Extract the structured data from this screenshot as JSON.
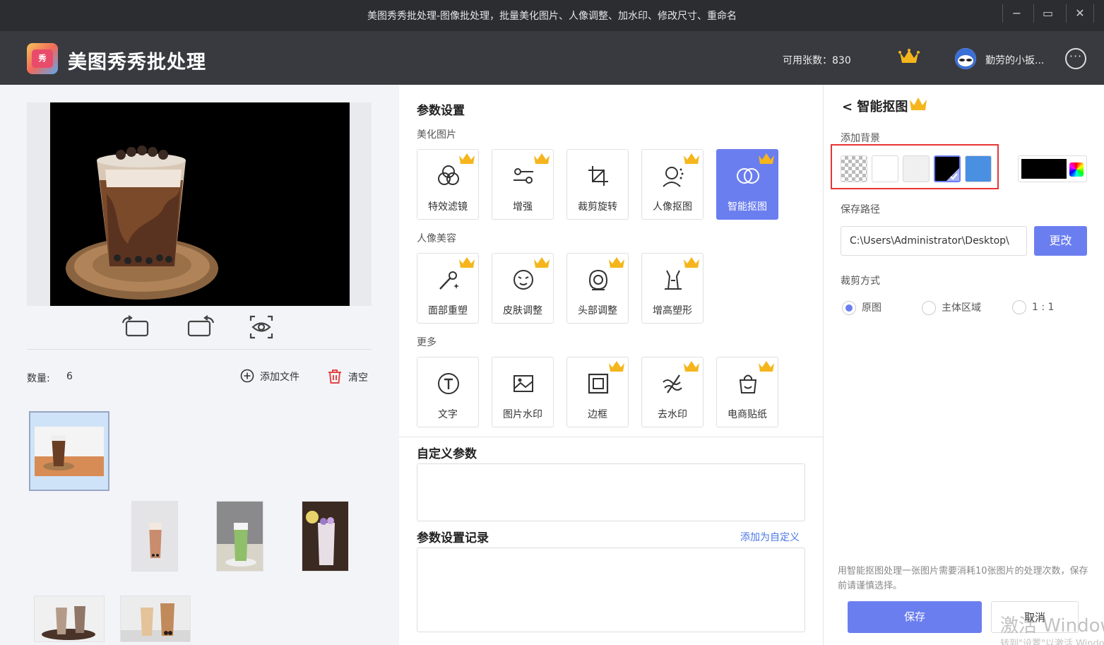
{
  "window": {
    "title": "美图秀秀批处理-图像批处理，批量美化图片、人像调整、加水印、修改尺寸、重命名",
    "minimize": "−",
    "maximize": "▭",
    "close": "✕"
  },
  "header": {
    "logo_text": "秀",
    "app_title": "美图秀秀批处理",
    "quota": "可用张数：830",
    "username": "勤劳的小扳...",
    "more": "···"
  },
  "left": {
    "count_label": "数量:",
    "count_value": "6",
    "add_file": "添加文件",
    "clear": "清空"
  },
  "middle": {
    "params_title": "参数设置",
    "group_beautify": "美化图片",
    "beautify_tools": [
      {
        "label": "特效滤镜",
        "icon": "filter-icon"
      },
      {
        "label": "增强",
        "icon": "sliders-icon"
      },
      {
        "label": "裁剪旋转",
        "icon": "crop-icon"
      },
      {
        "label": "人像抠图",
        "icon": "portrait-cutout-icon"
      },
      {
        "label": "智能抠图",
        "icon": "smart-cutout-icon"
      }
    ],
    "group_portrait": "人像美容",
    "portrait_tools": [
      {
        "label": "面部重塑",
        "icon": "magic-wand-icon"
      },
      {
        "label": "皮肤调整",
        "icon": "face-icon"
      },
      {
        "label": "头部调整",
        "icon": "head-icon"
      },
      {
        "label": "增高塑形",
        "icon": "body-icon"
      }
    ],
    "group_more": "更多",
    "more_tools": [
      {
        "label": "文字",
        "icon": "text-icon"
      },
      {
        "label": "图片水印",
        "icon": "image-watermark-icon"
      },
      {
        "label": "边框",
        "icon": "frame-icon"
      },
      {
        "label": "去水印",
        "icon": "remove-watermark-icon"
      },
      {
        "label": "电商贴纸",
        "icon": "sticker-icon"
      }
    ],
    "custom_title": "自定义参数",
    "history_title": "参数设置记录",
    "add_custom": "添加为自定义"
  },
  "right": {
    "back_title": "< 智能抠图",
    "bg_label": "添加背景",
    "save_path_label": "保存路径",
    "save_path_value": "C:\\Users\\Administrator\\Desktop\\",
    "change_btn": "更改",
    "crop_label": "裁剪方式",
    "crop_options": [
      "原图",
      "主体区域",
      "1 : 1"
    ],
    "note": "用智能抠图处理一张图片需要消耗10张图片的处理次数，保存前请谨慎选择。",
    "save_btn": "保存",
    "cancel_btn": "取消",
    "watermark_line1": "激活 Windows",
    "watermark_line2": "转到\"设置\"以激活 Windows。"
  },
  "colors": {
    "accent": "#6b7ef0",
    "highlight_box": "#e83535",
    "swatches": [
      "transparent",
      "#ffffff",
      "#f0f0f0",
      "#000000",
      "#4a90e2"
    ],
    "current_color": "#000000"
  }
}
